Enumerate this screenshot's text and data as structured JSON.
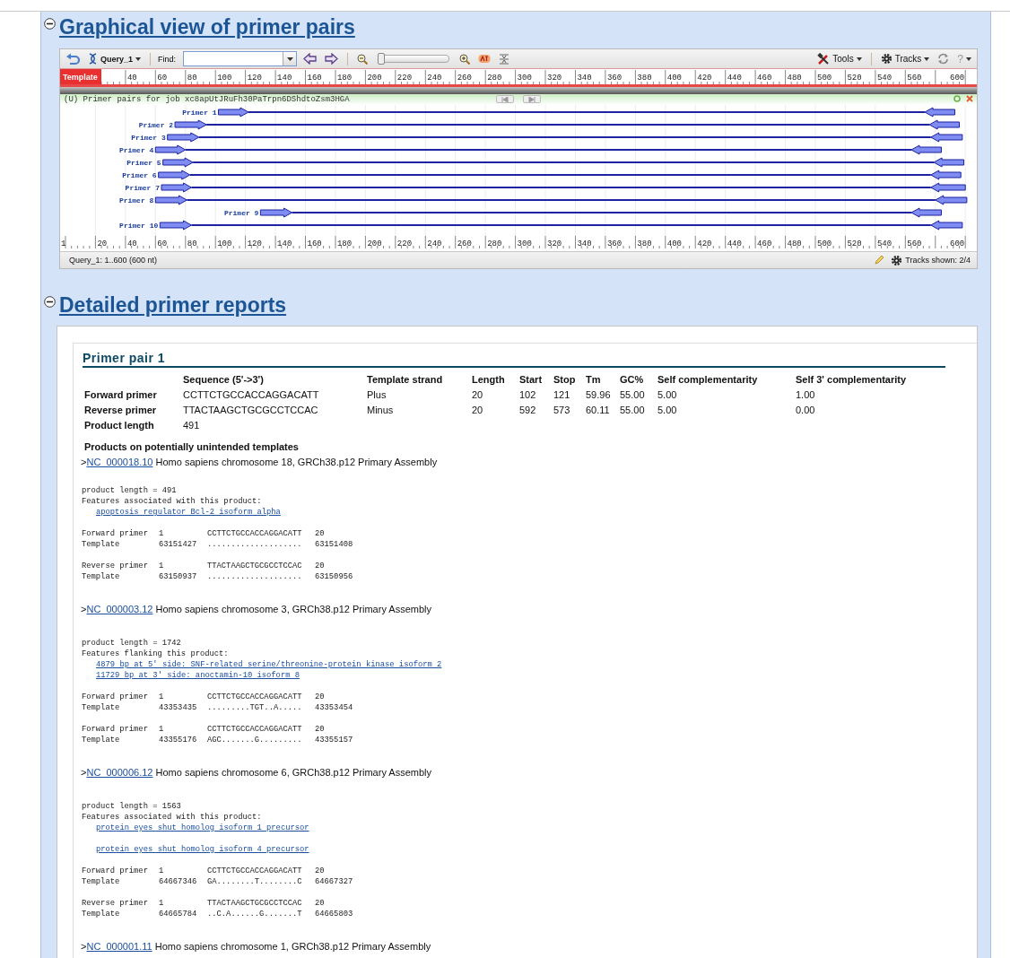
{
  "graphical_view": {
    "title": "Graphical view of primer pairs",
    "expanded": true,
    "toolbar": {
      "query": "Query_1",
      "find_label": "Find:",
      "zoom_slider": {
        "level": 0.03
      },
      "tools": "Tools",
      "tracks": "Tracks",
      "help": "?"
    },
    "template_label": "Template",
    "top_ruler": [
      "40",
      "60",
      "80",
      "100",
      "120",
      "140",
      "160",
      "180",
      "200",
      "220",
      "240",
      "260",
      "280",
      "300",
      "320",
      "340",
      "360",
      "380",
      "400",
      "420",
      "440",
      "460",
      "480",
      "500",
      "520",
      "540",
      "560",
      "600"
    ],
    "track_title": "(U) Primer pairs for job xc8apUtJRuFh30PaTrpn6DShdtoZsm3HGA",
    "primers": [
      {
        "name": "Primer 1"
      },
      {
        "name": "Primer 2"
      },
      {
        "name": "Primer 3"
      },
      {
        "name": "Primer 4"
      },
      {
        "name": "Primer 5"
      },
      {
        "name": "Primer 6"
      },
      {
        "name": "Primer 7"
      },
      {
        "name": "Primer 8"
      },
      {
        "name": "Primer 9"
      },
      {
        "name": "Primer 10"
      }
    ],
    "bottom_ruler": [
      "1",
      "20",
      "40",
      "60",
      "80",
      "100",
      "120",
      "140",
      "160",
      "180",
      "200",
      "220",
      "240",
      "260",
      "280",
      "300",
      "320",
      "340",
      "360",
      "380",
      "400",
      "420",
      "440",
      "460",
      "480",
      "500",
      "520",
      "540",
      "560",
      "600"
    ],
    "status": "Query_1: 1..600 (600 nt)",
    "tracks_shown": "Tracks shown: 2/4"
  },
  "detailed_reports": {
    "title": "Detailed primer reports",
    "expanded": true,
    "pair_title": "Primer pair 1",
    "columns": [
      "Sequence (5'->3')",
      "Template strand",
      "Length",
      "Start",
      "Stop",
      "Tm",
      "GC%",
      "Self complementarity",
      "Self 3' complementarity"
    ],
    "rows": [
      {
        "label": "Forward primer",
        "cells": [
          "CCTTCTGCCACCAGGACATT",
          "Plus",
          "20",
          "102",
          "121",
          "59.96",
          "55.00",
          "5.00",
          "1.00"
        ]
      },
      {
        "label": "Reverse primer",
        "cells": [
          "TTACTAAGCTGCGCCTCCAC",
          "Minus",
          "20",
          "592",
          "573",
          "60.11",
          "55.00",
          "5.00",
          "0.00"
        ]
      },
      {
        "label": "Product length",
        "cells": [
          "491"
        ]
      }
    ],
    "products_heading": "Products on potentially unintended templates",
    "products": [
      {
        "prefix": ">",
        "accession": "NC_000018.10",
        "description": "Homo sapiens chromosome 18, GRCh38.p12 Primary Assembly",
        "product_length": "product length = 491",
        "features_label": "Features associated with this product:",
        "feature_groups": [
          [
            "apoptosis regulator Bcl-2 isoform alpha"
          ]
        ],
        "alignments": [
          {
            "primer_label": "Forward primer",
            "primer_start": "1",
            "primer_seq": "CCTTCTGCCACCAGGACATT",
            "primer_end": "20",
            "template_label": "Template",
            "template_start": "63151427",
            "template_seq": "....................",
            "template_end": "63151408"
          },
          {
            "primer_label": "Reverse primer",
            "primer_start": "1",
            "primer_seq": "TTACTAAGCTGCGCCTCCAC",
            "primer_end": "20",
            "template_label": "Template",
            "template_start": "63150937",
            "template_seq": "....................",
            "template_end": "63150956"
          }
        ]
      },
      {
        "prefix": ">",
        "accession": "NC_000003.12",
        "description": "Homo sapiens chromosome 3, GRCh38.p12 Primary Assembly",
        "product_length": "product length = 1742",
        "features_label": "Features flanking this product:",
        "feature_groups": [
          [
            "4879 bp at 5' side: SNF-related serine/threonine-protein kinase isoform 2",
            "11729 bp at 3' side: anoctamin-10 isoform 8"
          ]
        ],
        "alignments": [
          {
            "primer_label": "Forward primer",
            "primer_start": "1",
            "primer_seq": "CCTTCTGCCACCAGGACATT",
            "primer_end": "20",
            "template_label": "Template",
            "template_start": "43353435",
            "template_seq": ".........TGT..A.....",
            "template_end": "43353454"
          },
          {
            "primer_label": "Forward primer",
            "primer_start": "1",
            "primer_seq": "CCTTCTGCCACCAGGACATT",
            "primer_end": "20",
            "template_label": "Template",
            "template_start": "43355176",
            "template_seq": "AGC.......G.........",
            "template_end": "43355157"
          }
        ]
      },
      {
        "prefix": ">",
        "accession": "NC_000006.12",
        "description": "Homo sapiens chromosome 6, GRCh38.p12 Primary Assembly",
        "product_length": "product length = 1563",
        "features_label": "Features associated with this product:",
        "feature_groups": [
          [
            "protein eyes shut homolog isoform 1 precursor"
          ],
          [
            "protein eyes shut homolog isoform 4 precursor"
          ]
        ],
        "alignments": [
          {
            "primer_label": "Forward primer",
            "primer_start": "1",
            "primer_seq": "CCTTCTGCCACCAGGACATT",
            "primer_end": "20",
            "template_label": "Template",
            "template_start": "64667346",
            "template_seq": "GA........T........C",
            "template_end": "64667327"
          },
          {
            "primer_label": "Reverse primer",
            "primer_start": "1",
            "primer_seq": "TTACTAAGCTGCGCCTCCAC",
            "primer_end": "20",
            "template_label": "Template",
            "template_start": "64665784",
            "template_seq": "..C.A......G.......T",
            "template_end": "64665803"
          }
        ]
      },
      {
        "prefix": ">",
        "accession": "NC_000001.11",
        "description": "Homo sapiens chromosome 1, GRCh38.p12 Primary Assembly"
      }
    ]
  }
}
